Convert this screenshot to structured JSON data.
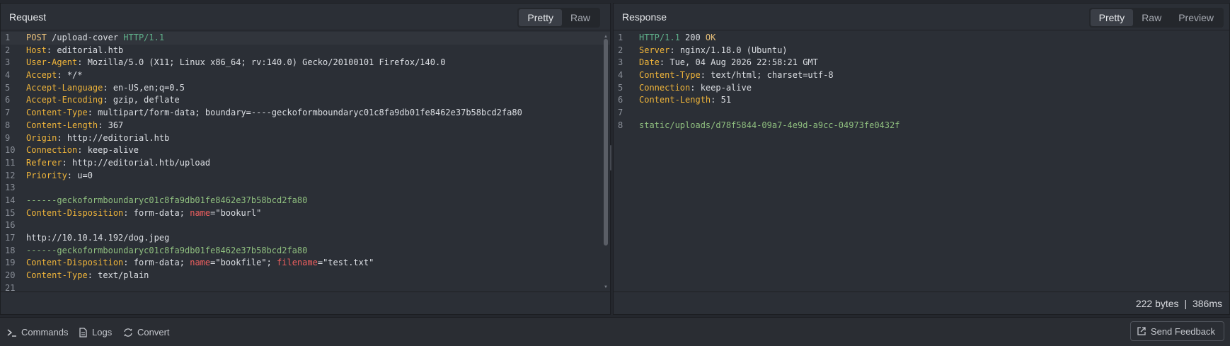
{
  "request": {
    "title": "Request",
    "tabs": [
      "Pretty",
      "Raw"
    ],
    "active_tab": "Pretty",
    "lines": [
      {
        "n": "1",
        "type": "reqline",
        "method": "POST",
        "path": " /upload-cover ",
        "proto": "HTTP/1.1",
        "highlight": true
      },
      {
        "n": "2",
        "type": "header",
        "name": "Host",
        "value": "editorial.htb"
      },
      {
        "n": "3",
        "type": "header",
        "name": "User-Agent",
        "value": "Mozilla/5.0 (X11; Linux x86_64; rv:140.0) Gecko/20100101 Firefox/140.0"
      },
      {
        "n": "4",
        "type": "header",
        "name": "Accept",
        "value": "*/*"
      },
      {
        "n": "5",
        "type": "header",
        "name": "Accept-Language",
        "value": "en-US,en;q=0.5"
      },
      {
        "n": "6",
        "type": "header",
        "name": "Accept-Encoding",
        "value": "gzip, deflate"
      },
      {
        "n": "7",
        "type": "header",
        "name": "Content-Type",
        "value": "multipart/form-data; boundary=----geckoformboundaryc01c8fa9db01fe8462e37b58bcd2fa80"
      },
      {
        "n": "8",
        "type": "header",
        "name": "Content-Length",
        "value": "367"
      },
      {
        "n": "9",
        "type": "header",
        "name": "Origin",
        "value": "http://editorial.htb"
      },
      {
        "n": "10",
        "type": "header",
        "name": "Connection",
        "value": "keep-alive"
      },
      {
        "n": "11",
        "type": "header",
        "name": "Referer",
        "value": "http://editorial.htb/upload"
      },
      {
        "n": "12",
        "type": "header",
        "name": "Priority",
        "value": "u=0"
      },
      {
        "n": "13",
        "type": "blank"
      },
      {
        "n": "14",
        "type": "boundary",
        "text": "------geckoformboundaryc01c8fa9db01fe8462e37b58bcd2fa80"
      },
      {
        "n": "15",
        "type": "disposition",
        "name": "Content-Disposition",
        "parts": [
          {
            "t": "text",
            "v": "form-data; "
          },
          {
            "t": "attr",
            "v": "name"
          },
          {
            "t": "text",
            "v": "=\"bookurl\""
          }
        ]
      },
      {
        "n": "16",
        "type": "blank"
      },
      {
        "n": "17",
        "type": "plain",
        "text": "http://10.10.14.192/dog.jpeg"
      },
      {
        "n": "18",
        "type": "boundary",
        "text": "------geckoformboundaryc01c8fa9db01fe8462e37b58bcd2fa80"
      },
      {
        "n": "19",
        "type": "disposition",
        "name": "Content-Disposition",
        "parts": [
          {
            "t": "text",
            "v": "form-data; "
          },
          {
            "t": "attr",
            "v": "name"
          },
          {
            "t": "text",
            "v": "=\"bookfile\"; "
          },
          {
            "t": "attr",
            "v": "filename"
          },
          {
            "t": "text",
            "v": "=\"test.txt\""
          }
        ]
      },
      {
        "n": "20",
        "type": "header",
        "name": "Content-Type",
        "value": "text/plain"
      },
      {
        "n": "21",
        "type": "blank"
      }
    ]
  },
  "response": {
    "title": "Response",
    "tabs": [
      "Pretty",
      "Raw",
      "Preview"
    ],
    "active_tab": "Pretty",
    "lines": [
      {
        "n": "1",
        "type": "statusline",
        "proto": "HTTP/1.1",
        "code": " 200 ",
        "msg": "OK"
      },
      {
        "n": "2",
        "type": "header",
        "name": "Server",
        "value": "nginx/1.18.0 (Ubuntu)"
      },
      {
        "n": "3",
        "type": "header",
        "name": "Date",
        "value": "Tue, 04 Aug 2026 22:58:21 GMT"
      },
      {
        "n": "4",
        "type": "header",
        "name": "Content-Type",
        "value": "text/html; charset=utf-8"
      },
      {
        "n": "5",
        "type": "header",
        "name": "Connection",
        "value": "keep-alive"
      },
      {
        "n": "6",
        "type": "header",
        "name": "Content-Length",
        "value": "51"
      },
      {
        "n": "7",
        "type": "blank"
      },
      {
        "n": "8",
        "type": "body",
        "text": "static/uploads/d78f5844-09a7-4e9d-a9cc-04973fe0432f"
      }
    ],
    "stats": {
      "size": "222 bytes",
      "separator": "|",
      "time": "386ms"
    }
  },
  "bottom_bar": {
    "commands": "Commands",
    "logs": "Logs",
    "convert": "Convert",
    "feedback": "Send Feedback"
  },
  "colors": {
    "accent_header": "#f0b53a",
    "attr": "#ef5f5f",
    "boundary": "#8fbf7f",
    "proto": "#5fb08a"
  }
}
